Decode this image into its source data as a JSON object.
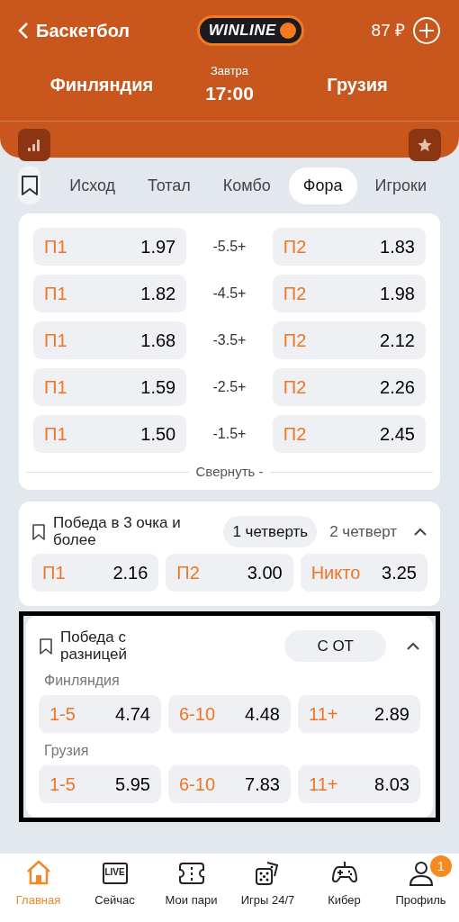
{
  "header": {
    "back_label": "Баскетбол",
    "logo": "WINLINE",
    "balance": "87 ₽",
    "home_team": "Финляндия",
    "day": "Завтра",
    "time": "17:00",
    "away_team": "Грузия"
  },
  "tabs": [
    {
      "label": "Исход",
      "selected": false
    },
    {
      "label": "Тотал",
      "selected": false
    },
    {
      "label": "Комбо",
      "selected": false
    },
    {
      "label": "Фора",
      "selected": true
    },
    {
      "label": "Игроки",
      "selected": false
    }
  ],
  "handicap": {
    "rows": [
      {
        "left_label": "П1",
        "left_odds": "1.97",
        "line": "-5.5+",
        "right_label": "П2",
        "right_odds": "1.83"
      },
      {
        "left_label": "П1",
        "left_odds": "1.82",
        "line": "-4.5+",
        "right_label": "П2",
        "right_odds": "1.98"
      },
      {
        "left_label": "П1",
        "left_odds": "1.68",
        "line": "-3.5+",
        "right_label": "П2",
        "right_odds": "2.12"
      },
      {
        "left_label": "П1",
        "left_odds": "1.59",
        "line": "-2.5+",
        "right_label": "П2",
        "right_odds": "2.26"
      },
      {
        "left_label": "П1",
        "left_odds": "1.50",
        "line": "-1.5+",
        "right_label": "П2",
        "right_odds": "2.45"
      }
    ],
    "collapse": "Свернуть -"
  },
  "markets": [
    {
      "title": "Победа в 3 очка и более",
      "highlighted": false,
      "periods": [
        {
          "label": "1 четверть",
          "selected": true
        },
        {
          "label": "2 четверт",
          "selected": false
        }
      ],
      "groups": [
        {
          "outcomes": [
            {
              "label": "П1",
              "odds": "2.16"
            },
            {
              "label": "П2",
              "odds": "3.00"
            },
            {
              "label": "Никто",
              "odds": "3.25"
            }
          ]
        }
      ]
    },
    {
      "title": "Победа с разницей",
      "highlighted": true,
      "periods": [
        {
          "label": "С ОТ",
          "selected": true
        }
      ],
      "groups": [
        {
          "team": "Финляндия",
          "outcomes": [
            {
              "label": "1-5",
              "odds": "4.74"
            },
            {
              "label": "6-10",
              "odds": "4.48"
            },
            {
              "label": "11+",
              "odds": "2.89"
            }
          ]
        },
        {
          "team": "Грузия",
          "outcomes": [
            {
              "label": "1-5",
              "odds": "5.95"
            },
            {
              "label": "6-10",
              "odds": "7.83"
            },
            {
              "label": "11+",
              "odds": "8.03"
            }
          ]
        }
      ]
    }
  ],
  "nav": [
    {
      "kind": "home",
      "label": "Главная",
      "selected": true
    },
    {
      "kind": "live",
      "label": "Сейчас",
      "selected": false,
      "icon_text": "LIVE"
    },
    {
      "kind": "ticket",
      "label": "Мои пари",
      "selected": false
    },
    {
      "kind": "dice",
      "label": "Игры 24/7",
      "selected": false
    },
    {
      "kind": "gamepad",
      "label": "Кибер",
      "selected": false
    },
    {
      "kind": "profile",
      "label": "Профиль",
      "selected": false,
      "badge": "1"
    }
  ]
}
